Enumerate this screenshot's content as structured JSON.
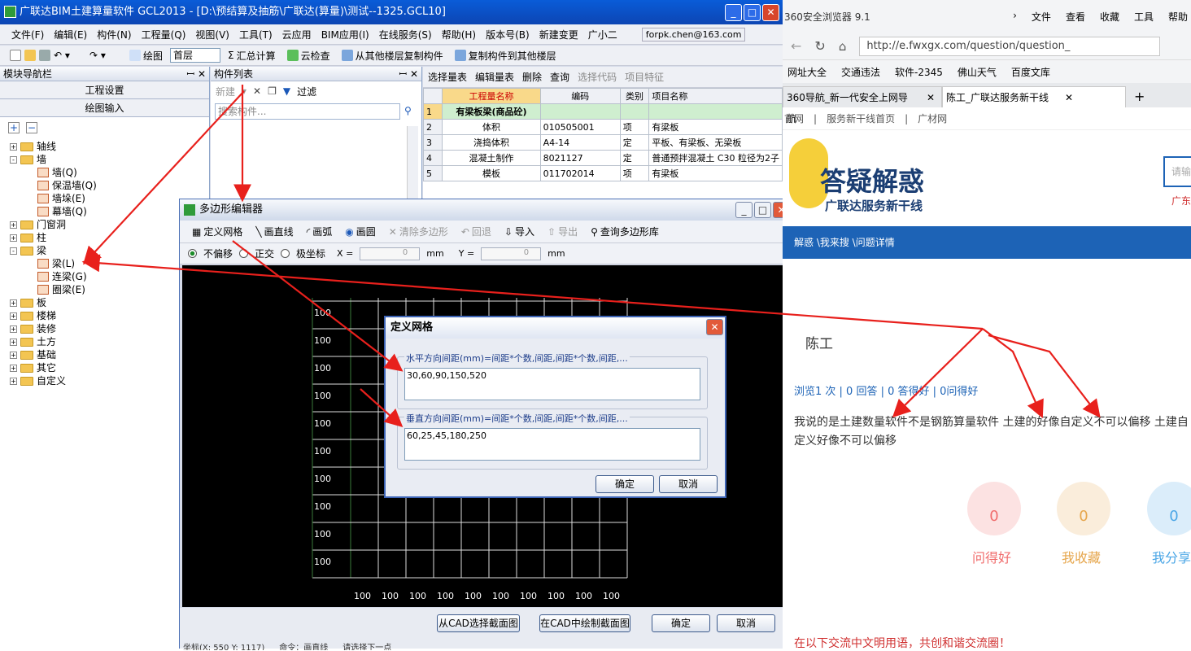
{
  "app": {
    "title": "广联达BIM土建算量软件 GCL2013 - [D:\\预结算及抽筋\\广联达(算量)\\测试--1325.GCL10]",
    "menu": [
      "文件(F)",
      "编辑(E)",
      "构件(N)",
      "工程量(Q)",
      "视图(V)",
      "工具(T)",
      "云应用",
      "BIM应用(I)",
      "在线服务(S)",
      "帮助(H)",
      "版本号(B)",
      "新建变更",
      "广小二"
    ],
    "account": "forpk.chen@163.com",
    "toolbar": {
      "draw": "绘图",
      "floor": "首层",
      "summary": "汇总计算",
      "cloud_check": "云检查",
      "copy_from": "从其他楼层复制构件",
      "copy_to": "复制构件到其他楼层"
    }
  },
  "nav": {
    "title": "模块导航栏",
    "tabs": [
      "工程设置",
      "绘图输入"
    ],
    "tree": [
      {
        "label": "轴线",
        "type": "folder",
        "exp": "+"
      },
      {
        "label": "墙",
        "type": "folder",
        "exp": "-"
      },
      {
        "label": "墙(Q)",
        "type": "leaf"
      },
      {
        "label": "保温墙(Q)",
        "type": "leaf"
      },
      {
        "label": "墙垛(E)",
        "type": "leaf"
      },
      {
        "label": "幕墙(Q)",
        "type": "leaf"
      },
      {
        "label": "门窗洞",
        "type": "folder",
        "exp": "+"
      },
      {
        "label": "柱",
        "type": "folder",
        "exp": "+"
      },
      {
        "label": "梁",
        "type": "folder",
        "exp": "-"
      },
      {
        "label": "梁(L)",
        "type": "leaf"
      },
      {
        "label": "连梁(G)",
        "type": "leaf"
      },
      {
        "label": "圈梁(E)",
        "type": "leaf"
      },
      {
        "label": "板",
        "type": "folder",
        "exp": "+"
      },
      {
        "label": "楼梯",
        "type": "folder",
        "exp": "+"
      },
      {
        "label": "装修",
        "type": "folder",
        "exp": "+"
      },
      {
        "label": "土方",
        "type": "folder",
        "exp": "+"
      },
      {
        "label": "基础",
        "type": "folder",
        "exp": "+"
      },
      {
        "label": "其它",
        "type": "folder",
        "exp": "+"
      },
      {
        "label": "自定义",
        "type": "folder",
        "exp": "+"
      }
    ]
  },
  "comp": {
    "title": "构件列表",
    "new": "新建",
    "filter": "过滤",
    "search_placeholder": "搜索构件..."
  },
  "qty": {
    "toolbar": [
      "选择量表",
      "编辑量表",
      "删除",
      "查询",
      "选择代码",
      "项目特征"
    ],
    "headers": [
      "工程量名称",
      "编码",
      "类别",
      "项目名称"
    ],
    "rows": [
      {
        "n": "1",
        "name": "有梁板梁(商品砼)",
        "code": "",
        "cat": "",
        "item": ""
      },
      {
        "n": "2",
        "name": "体积",
        "code": "010505001",
        "cat": "项",
        "item": "有梁板"
      },
      {
        "n": "3",
        "name": "浇捣体积",
        "code": "A4-14",
        "cat": "定",
        "item": "平板、有梁板、无梁板"
      },
      {
        "n": "4",
        "name": "混凝土制作",
        "code": "8021127",
        "cat": "定",
        "item": "普通预拌混凝土 C30 粒径为2子"
      },
      {
        "n": "5",
        "name": "模板",
        "code": "011702014",
        "cat": "项",
        "item": "有梁板"
      }
    ]
  },
  "poly": {
    "title": "多边形编辑器",
    "toolbar": [
      "定义网格",
      "画直线",
      "画弧",
      "画圆",
      "清除多边形",
      "回退",
      "导入",
      "导出",
      "查询多边形库"
    ],
    "modes": [
      "不偏移",
      "正交",
      "极坐标"
    ],
    "x_label": "X =",
    "y_label": "Y =",
    "x_val": "0",
    "y_val": "0",
    "unit": "mm",
    "grid_label": "100",
    "buttons": [
      "从CAD选择截面图",
      "在CAD中绘制截面图",
      "确定",
      "取消"
    ],
    "status": [
      "坐标(X: 550 Y: 1117)",
      "命令：画直线",
      "请选择下一点"
    ]
  },
  "dialog": {
    "title": "定义网格",
    "h_label": "水平方向间距(mm)=间距*个数,间距,间距*个数,间距,...",
    "h_value": "30,60,90,150,520",
    "v_label": "垂直方向间距(mm)=间距*个数,间距,间距*个数,间距,...",
    "v_value": "60,25,45,180,250",
    "ok": "确定",
    "cancel": "取消"
  },
  "browser": {
    "title": "360安全浏览器 9.1",
    "menus": [
      "文件",
      "查看",
      "收藏",
      "工具",
      "帮助"
    ],
    "url": "http://e.fwxgx.com/question/question_",
    "favs": [
      "网址大全",
      "交通违法",
      "软件-2345",
      "佛山天气",
      "百度文库"
    ],
    "tabs": [
      "360导航_新一代安全上网导航",
      "陈工_广联达服务新干线"
    ],
    "site_nav": [
      "首网",
      "服务新干线首页",
      "广材网"
    ],
    "logo_main": "答疑解惑",
    "logo_sub": "广联达服务新干线",
    "search_hint": "请输",
    "region": "广东",
    "breadcrumb": "解惑 \\我来搜 \\问题详情",
    "author": "陈工",
    "stats": "浏览1 次 | 0 回答 | 0 答得好 | 0问得好",
    "question": "我说的是土建数量软件不是钢筋算量软件 土建的好像自定义不可以偏移 土建自定义好像不可以偏移",
    "actions": [
      {
        "n": "0",
        "label": "问得好",
        "color": "#f06c6c"
      },
      {
        "n": "0",
        "label": "我收藏",
        "color": "#e6a64c"
      },
      {
        "n": "0",
        "label": "我分享",
        "color": "#4aa6e6"
      }
    ],
    "footer": "在以下交流中文明用语，共创和谐交流圈！"
  }
}
